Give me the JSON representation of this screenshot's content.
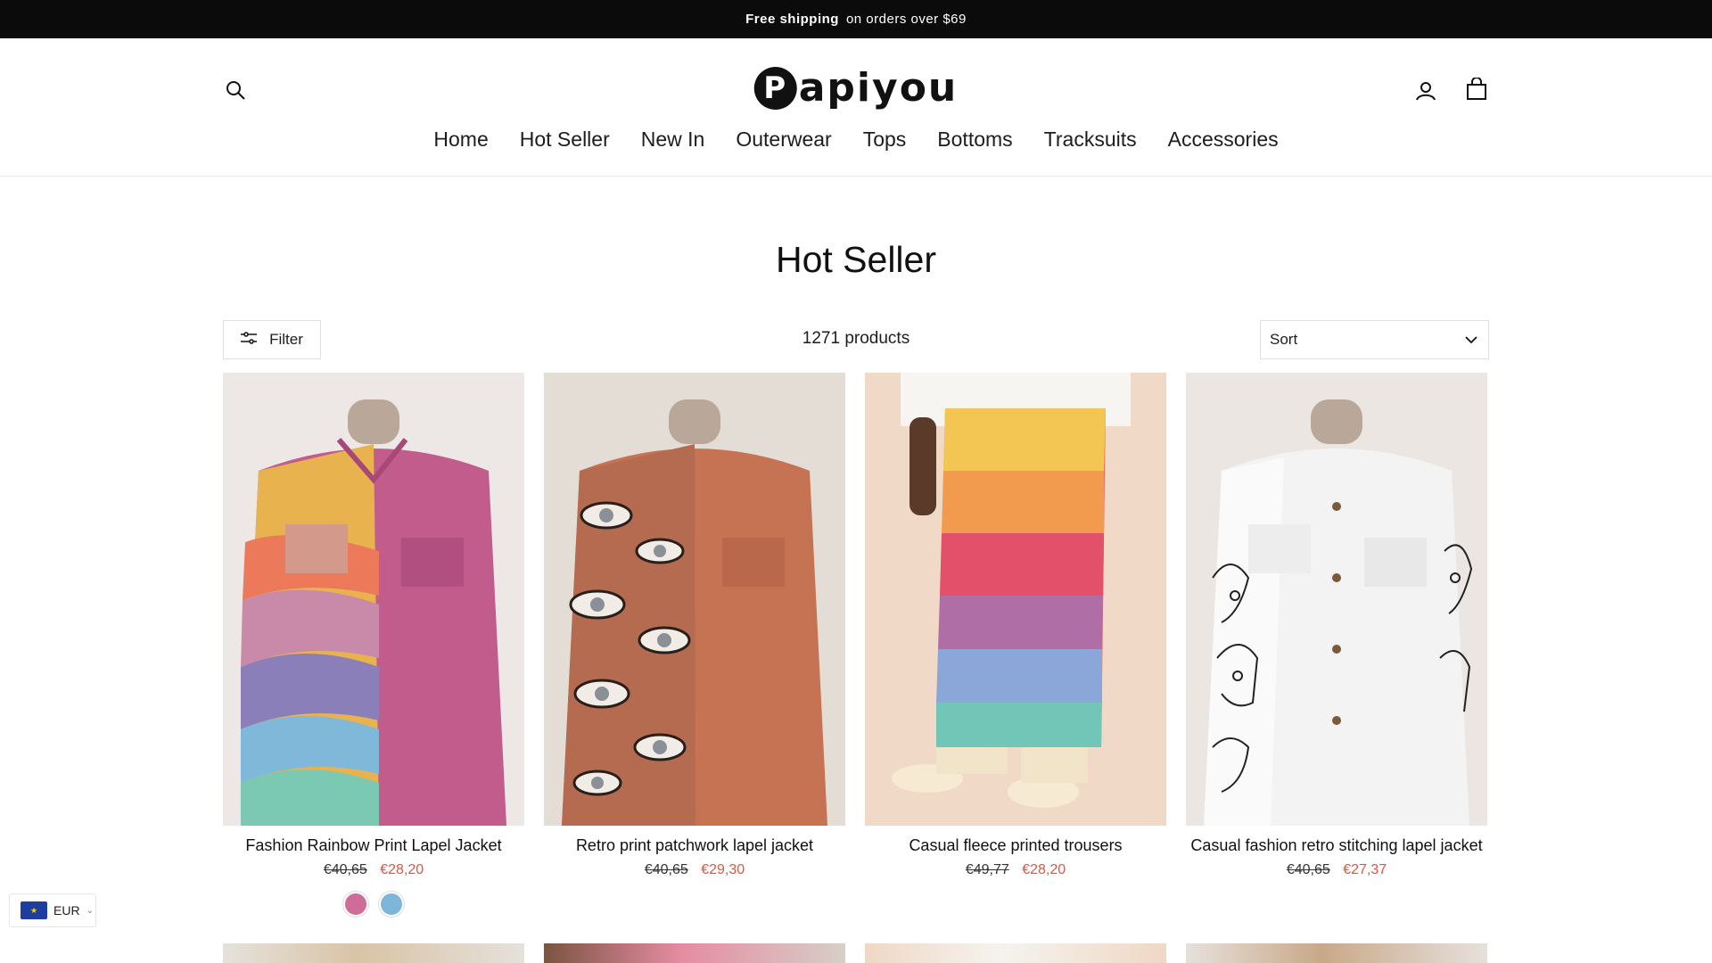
{
  "announcement": {
    "strong": "Free shipping",
    "text": "on orders over $69"
  },
  "header": {
    "logo": "Papiyou"
  },
  "nav": [
    "Home",
    "Hot Seller",
    "New In",
    "Outerwear",
    "Tops",
    "Bottoms",
    "Tracksuits",
    "Accessories"
  ],
  "collection": {
    "title": "Hot Seller",
    "count": "1271 products"
  },
  "toolbar": {
    "filter_label": "Filter",
    "sort_label": "Sort"
  },
  "products": [
    {
      "title": "Fashion Rainbow Print Lapel Jacket",
      "old_price": "€40,65",
      "new_price": "€28,20"
    },
    {
      "title": "Retro print patchwork lapel jacket",
      "old_price": "€40,65",
      "new_price": "€29,30"
    },
    {
      "title": "Casual fleece printed trousers",
      "old_price": "€49,77",
      "new_price": "€28,20"
    },
    {
      "title": "Casual fashion retro stitching lapel jacket",
      "old_price": "€40,65",
      "new_price": "€27,37"
    }
  ],
  "currency": {
    "code": "EUR"
  },
  "colors": {
    "sale": "#e2553c",
    "announcement_bg": "#0b0b0b"
  }
}
